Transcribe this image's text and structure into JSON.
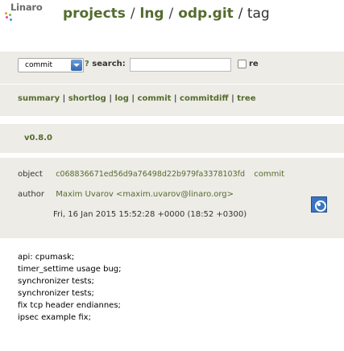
{
  "header": {
    "logo_text": "Linaro",
    "breadcrumb": [
      {
        "label": "projects",
        "link": true
      },
      {
        "label": "/",
        "link": false
      },
      {
        "label": "lng",
        "link": true
      },
      {
        "label": "/",
        "link": false
      },
      {
        "label": "odp.git",
        "link": true
      },
      {
        "label": "/ tag",
        "link": false
      }
    ]
  },
  "search": {
    "select_value": "commit",
    "help_label": "?",
    "label": "search:",
    "input_value": "",
    "re_label": "re"
  },
  "nav": {
    "items": [
      "summary",
      "shortlog",
      "log",
      "commit",
      "commitdiff",
      "tree"
    ]
  },
  "tag": {
    "name": "v0.8.0"
  },
  "object": {
    "object_label": "object",
    "hash": "c068836671ed56d9a76498d22b979fa3378103fd",
    "commit_link": "commit",
    "author_label": "author",
    "author": "Maxim Uvarov <maxim.uvarov@linaro.org>",
    "date": "Fri, 16 Jan 2015 15:52:28 +0000 (18:52 +0300)"
  },
  "message": {
    "lines": [
      "api: cpumask;",
      "timer_settime usage bug;",
      "synchronizer tests;",
      "synchronizer tests;",
      "fix tcp header endiannes;",
      "ipsec example fix;"
    ]
  },
  "colors": {
    "link": "#556b2f",
    "panel": "#edece6",
    "avatar": "#3a74c4"
  }
}
